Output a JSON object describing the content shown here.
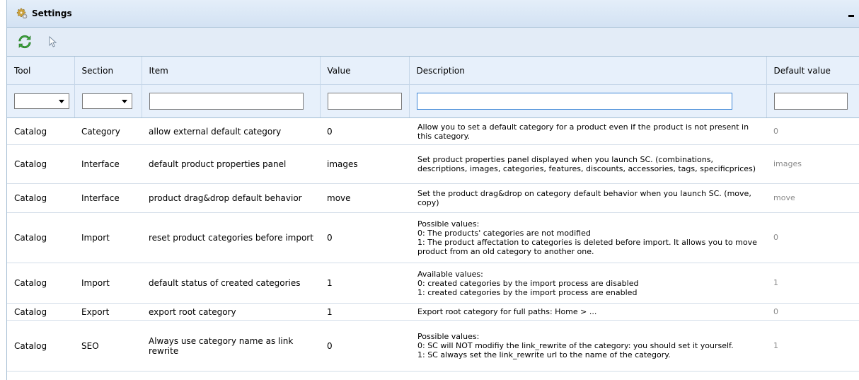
{
  "window": {
    "title": "Settings"
  },
  "columns": {
    "tool": "Tool",
    "section": "Section",
    "item": "Item",
    "value": "Value",
    "description": "Description",
    "default_value": "Default value"
  },
  "filters": {
    "tool": "",
    "section": "",
    "item": "",
    "value": "",
    "description": "",
    "default_value": ""
  },
  "rows": [
    {
      "tool": "Catalog",
      "section": "Category",
      "item": "allow external default category",
      "value": "0",
      "description": [
        "Allow you to set a default category for a product even if the product is not present in this category."
      ],
      "default_value": "0"
    },
    {
      "tool": "Catalog",
      "section": "Interface",
      "item": "default product properties panel",
      "value": "images",
      "description": [
        "Set product properties panel displayed when you launch SC. (combinations, descriptions, images, categories, features, discounts, accessories, tags, specificprices)"
      ],
      "default_value": "images"
    },
    {
      "tool": "Catalog",
      "section": "Interface",
      "item": "product drag&drop default behavior",
      "value": "move",
      "description": [
        "Set the product drag&drop on category default behavior when you launch SC. (move, copy)"
      ],
      "default_value": "move"
    },
    {
      "tool": "Catalog",
      "section": "Import",
      "item": "reset product categories before import",
      "value": "0",
      "description": [
        "Possible values:",
        "0: The products' categories are not modified",
        "1: The product affectation to categories is deleted before import. It allows you to move product from an old category to another one."
      ],
      "default_value": "0"
    },
    {
      "tool": "Catalog",
      "section": "Import",
      "item": "default status of created categories",
      "value": "1",
      "description": [
        "Available values:",
        "0: created categories by the import process are disabled",
        "1: created categories by the import process are enabled"
      ],
      "default_value": "1"
    },
    {
      "tool": "Catalog",
      "section": "Export",
      "item": "export root category",
      "value": "1",
      "description": [
        "Export root category for full paths: Home > ..."
      ],
      "default_value": "0"
    },
    {
      "tool": "Catalog",
      "section": "SEO",
      "item": "Always use category name as link rewrite",
      "value": "0",
      "description": [
        "Possible values:",
        "0: SC will NOT modifiy the link_rewrite of the category: you should set it yourself.",
        "1: SC always set the link_rewrite url to the name of the category."
      ],
      "default_value": "1"
    }
  ]
}
